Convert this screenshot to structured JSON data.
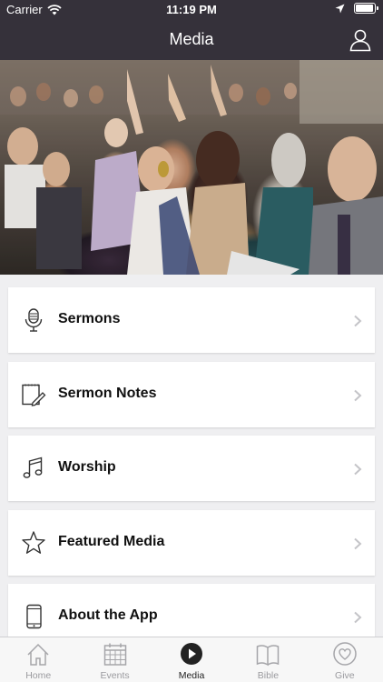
{
  "status_bar": {
    "carrier": "Carrier",
    "time": "11:19 PM"
  },
  "header": {
    "title": "Media"
  },
  "menu": [
    {
      "label": "Sermons",
      "icon": "microphone-icon"
    },
    {
      "label": "Sermon Notes",
      "icon": "notepad-pencil-icon"
    },
    {
      "label": "Worship",
      "icon": "music-note-icon"
    },
    {
      "label": "Featured Media",
      "icon": "star-icon"
    },
    {
      "label": "About the App",
      "icon": "phone-icon"
    }
  ],
  "tabs": [
    {
      "label": "Home",
      "icon": "home-icon",
      "active": false
    },
    {
      "label": "Events",
      "icon": "calendar-icon",
      "active": false
    },
    {
      "label": "Media",
      "icon": "play-icon",
      "active": true
    },
    {
      "label": "Bible",
      "icon": "book-icon",
      "active": false
    },
    {
      "label": "Give",
      "icon": "heart-icon",
      "active": false
    }
  ],
  "colors": {
    "header_bg": "#35313a",
    "page_bg": "#efeff1",
    "active_tab": "#222222",
    "inactive_tab": "#9a9a9e"
  }
}
